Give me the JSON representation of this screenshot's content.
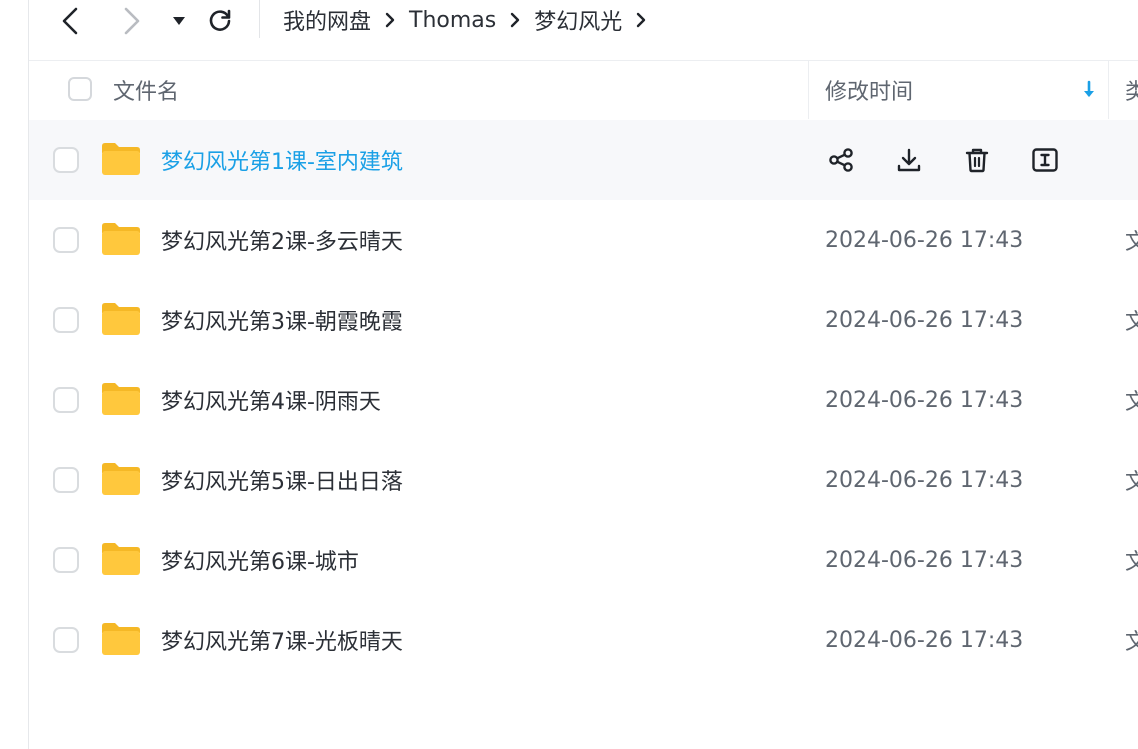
{
  "breadcrumb": {
    "items": [
      "我的网盘",
      "Thomas",
      "梦幻风光"
    ]
  },
  "table": {
    "headers": {
      "name": "文件名",
      "modified": "修改时间",
      "type": "类"
    },
    "rows": [
      {
        "name": "梦幻风光第1课-室内建筑",
        "modified": "",
        "type": ""
      },
      {
        "name": "梦幻风光第2课-多云晴天",
        "modified": "2024-06-26 17:43",
        "type": "文"
      },
      {
        "name": "梦幻风光第3课-朝霞晚霞",
        "modified": "2024-06-26 17:43",
        "type": "文"
      },
      {
        "name": "梦幻风光第4课-阴雨天",
        "modified": "2024-06-26 17:43",
        "type": "文"
      },
      {
        "name": "梦幻风光第5课-日出日落",
        "modified": "2024-06-26 17:43",
        "type": "文"
      },
      {
        "name": "梦幻风光第6课-城市",
        "modified": "2024-06-26 17:43",
        "type": "文"
      },
      {
        "name": "梦幻风光第7课-光板晴天",
        "modified": "2024-06-26 17:43",
        "type": "文"
      }
    ]
  },
  "hover_actions": [
    "share-icon",
    "download-icon",
    "delete-icon",
    "rename-icon"
  ],
  "colors": {
    "accent": "#1aa0e6",
    "folder": "#ffc83d",
    "text": "#2b2f36",
    "muted": "#5f6670"
  }
}
